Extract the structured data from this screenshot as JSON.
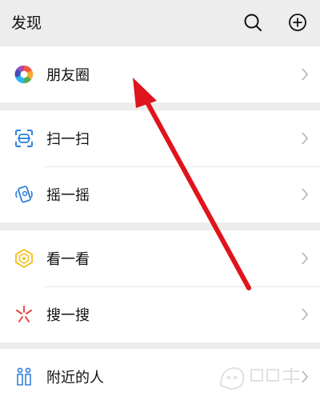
{
  "header": {
    "title": "发现"
  },
  "groups": [
    {
      "items": [
        {
          "label": "朋友圈",
          "icon": "moments-icon"
        }
      ]
    },
    {
      "items": [
        {
          "label": "扫一扫",
          "icon": "scan-icon"
        },
        {
          "label": "摇一摇",
          "icon": "shake-icon"
        }
      ]
    },
    {
      "items": [
        {
          "label": "看一看",
          "icon": "top-stories-icon"
        },
        {
          "label": "搜一搜",
          "icon": "search-sparkle-icon"
        }
      ]
    },
    {
      "items": [
        {
          "label": "附近的人",
          "icon": "people-nearby-icon"
        }
      ]
    }
  ],
  "colors": {
    "background": "#ededed",
    "row": "#ffffff",
    "annotation_arrow": "#e0141c",
    "icon_blue": "#2f7fd9",
    "icon_gold": "#f3c22b",
    "icon_red": "#e8453c"
  }
}
